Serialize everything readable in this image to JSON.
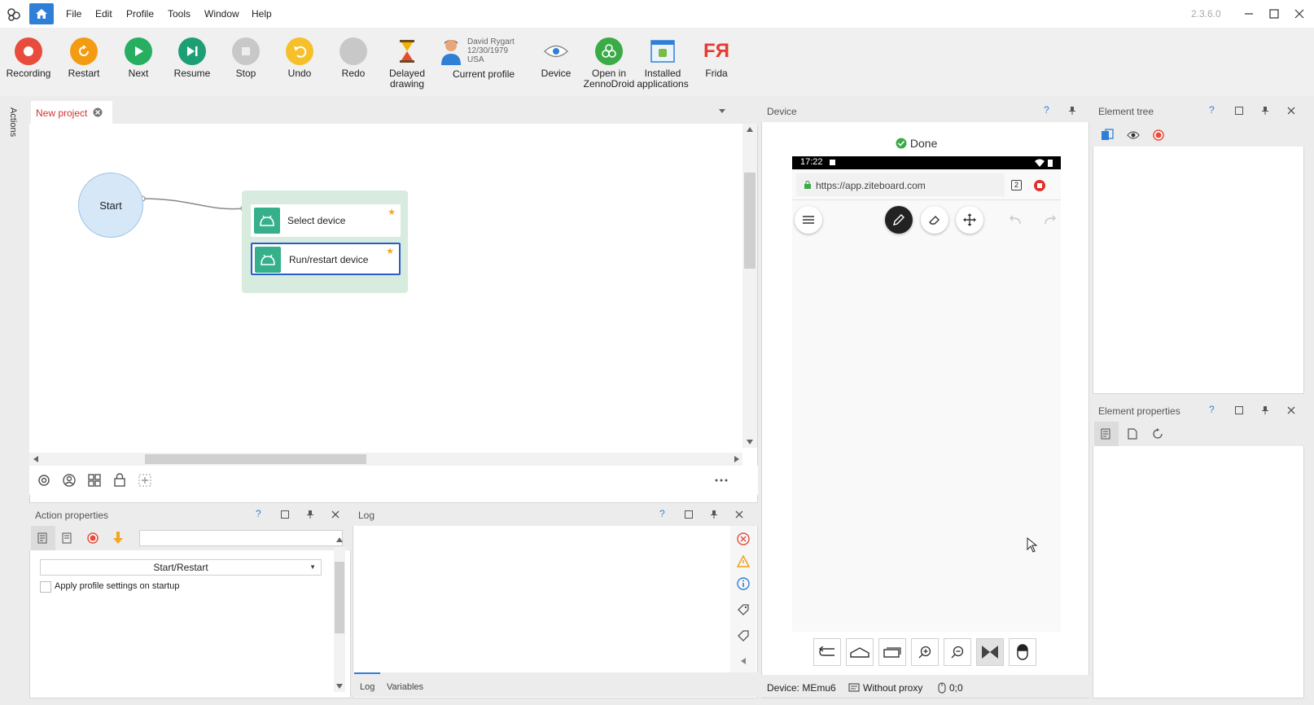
{
  "app": {
    "version": "2.3.6.0",
    "menu": [
      "File",
      "Edit",
      "Profile",
      "Tools",
      "Window",
      "Help"
    ]
  },
  "toolbar": {
    "recording": "Recording",
    "restart": "Restart",
    "next": "Next",
    "resume": "Resume",
    "stop": "Stop",
    "undo": "Undo",
    "redo": "Redo",
    "delayed_drawing": "Delayed drawing",
    "profile_name": "David Rygart",
    "profile_dob": "12/30/1979",
    "profile_country": "USA",
    "current_profile": "Current profile",
    "device": "Device",
    "open_in_zennodroid": "Open in ZennoDroid",
    "installed_applications": "Installed applications",
    "frida": "Frida",
    "frida_logo": "FЯ"
  },
  "sidebar": {
    "actions_label": "Actions"
  },
  "project": {
    "tab_label": "New project",
    "start_node": "Start",
    "nodes": [
      "Select device",
      "Run/restart device"
    ]
  },
  "action_properties": {
    "title": "Action properties",
    "help": "?",
    "search_value": "",
    "dropdown_value": "Start/Restart",
    "checkbox_label": "Apply profile settings on startup",
    "checkbox_checked": false
  },
  "log": {
    "title": "Log",
    "help": "?",
    "tabs": [
      "Log",
      "Variables"
    ],
    "active_tab": "Log"
  },
  "device": {
    "title": "Device",
    "help": "?",
    "status": "Done",
    "time": "17:22",
    "url": "https://app.ziteboard.com",
    "tab_count": "2",
    "device_name": "Device: MEmu6",
    "proxy": "Without proxy",
    "coords": "0;0"
  },
  "element_tree": {
    "title": "Element tree",
    "help": "?"
  },
  "element_properties": {
    "title": "Element properties",
    "help": "?"
  },
  "colors": {
    "accent_blue": "#2f7fd7",
    "recording_red": "#e74c3c",
    "restart_orange": "#f39c12",
    "next_green": "#27ae60",
    "resume_teal": "#1e9e74",
    "node_green": "#35b08b",
    "tab_red": "#d2342b"
  }
}
